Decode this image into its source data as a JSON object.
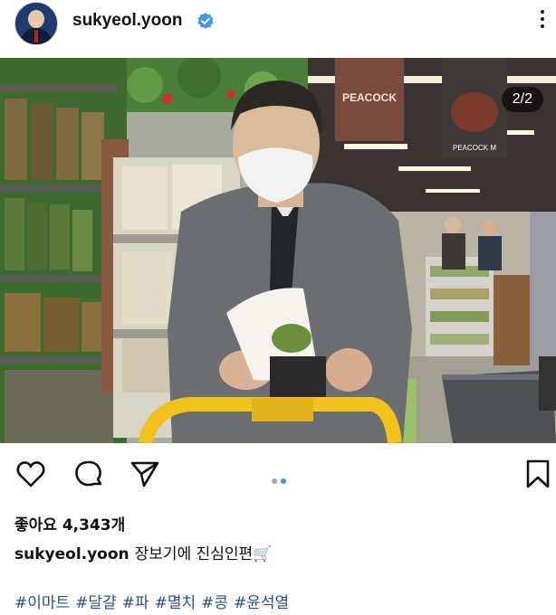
{
  "header": {
    "username": "sukyeol.yoon",
    "avatar_icon": "profile-photo",
    "verified_icon": "verified-badge-icon",
    "more_icon": "more-options-icon",
    "verified_color": "#3897f0"
  },
  "photo": {
    "counter": "2/2",
    "sign_text": "PEACOCK",
    "sign_small_text": "PEACOCK M"
  },
  "actions": {
    "like_icon": "heart-icon",
    "comment_icon": "comment-icon",
    "share_icon": "send-icon",
    "save_icon": "bookmark-icon",
    "carousel_total": 2,
    "carousel_active": 2,
    "active_dot_color": "#3897f0"
  },
  "likes": {
    "label": "좋아요 4,343개"
  },
  "caption": {
    "username": "sukyeol.yoon",
    "text": "장보기에 진심인편🛒"
  },
  "hashtags": [
    "#이마트",
    "#달걀",
    "#파",
    "#멸치",
    "#콩",
    "#윤석열"
  ],
  "colors": {
    "hashtag": "#2b4f8c"
  }
}
